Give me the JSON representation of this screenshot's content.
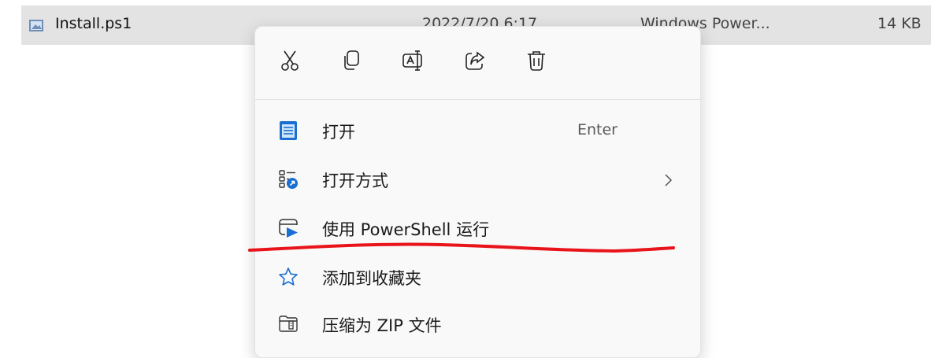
{
  "file": {
    "name": "Install.ps1",
    "date": "2022/7/20 6:17",
    "type": "Windows Power...",
    "size": "14 KB",
    "icon": "powershell-script-file-icon"
  },
  "context_menu": {
    "quick_actions": [
      {
        "name": "cut",
        "icon": "scissors-icon"
      },
      {
        "name": "copy",
        "icon": "copy-icon"
      },
      {
        "name": "rename",
        "icon": "rename-icon"
      },
      {
        "name": "share",
        "icon": "share-icon"
      },
      {
        "name": "delete",
        "icon": "trash-icon"
      }
    ],
    "items": [
      {
        "label": "打开",
        "shortcut": "Enter",
        "icon": "notepad-icon"
      },
      {
        "label": "打开方式",
        "icon": "open-with-icon",
        "has_submenu": true
      },
      {
        "label": "使用 PowerShell 运行",
        "icon": "powershell-run-icon"
      },
      {
        "label": "添加到收藏夹",
        "icon": "star-icon"
      },
      {
        "label": "压缩为 ZIP 文件",
        "icon": "zip-folder-icon"
      }
    ]
  },
  "colors": {
    "highlight_row": "#e3e3e3",
    "menu_bg": "#f9f9f9",
    "accent_blue": "#1a6fd0",
    "annotation_red": "#e8141a"
  }
}
